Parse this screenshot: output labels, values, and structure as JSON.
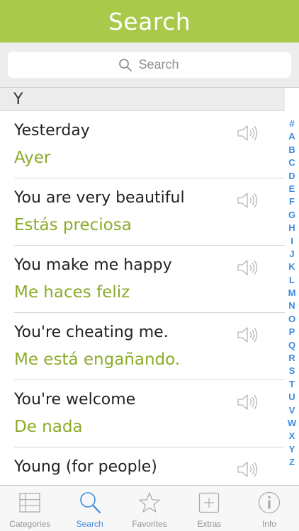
{
  "header": {
    "title": "Search"
  },
  "search": {
    "placeholder": "Search"
  },
  "section": {
    "letter": "Y"
  },
  "rows": [
    {
      "english": "Yesterday",
      "spanish": "Ayer"
    },
    {
      "english": "You are very beautiful",
      "spanish": "Estás preciosa"
    },
    {
      "english": "You make me happy",
      "spanish": "Me haces feliz"
    },
    {
      "english": "You're cheating me.",
      "spanish": "Me está engañando."
    },
    {
      "english": "You're welcome",
      "spanish": "De nada"
    },
    {
      "english": "Young (for people)",
      "spanish": ""
    }
  ],
  "index": [
    "#",
    "A",
    "B",
    "C",
    "D",
    "E",
    "F",
    "G",
    "H",
    "I",
    "J",
    "K",
    "L",
    "M",
    "N",
    "O",
    "P",
    "Q",
    "R",
    "S",
    "T",
    "U",
    "V",
    "W",
    "X",
    "Y",
    "Z"
  ],
  "tabs": [
    {
      "label": "Categories",
      "icon": "list-icon",
      "active": false
    },
    {
      "label": "Search",
      "icon": "search-icon",
      "active": true
    },
    {
      "label": "Favorites",
      "icon": "star-icon",
      "active": false
    },
    {
      "label": "Extras",
      "icon": "plus-icon",
      "active": false
    },
    {
      "label": "Info",
      "icon": "info-icon",
      "active": false
    }
  ],
  "colors": {
    "header": "#a9c94a",
    "translation": "#8cab2a",
    "accent": "#3a8be0"
  }
}
